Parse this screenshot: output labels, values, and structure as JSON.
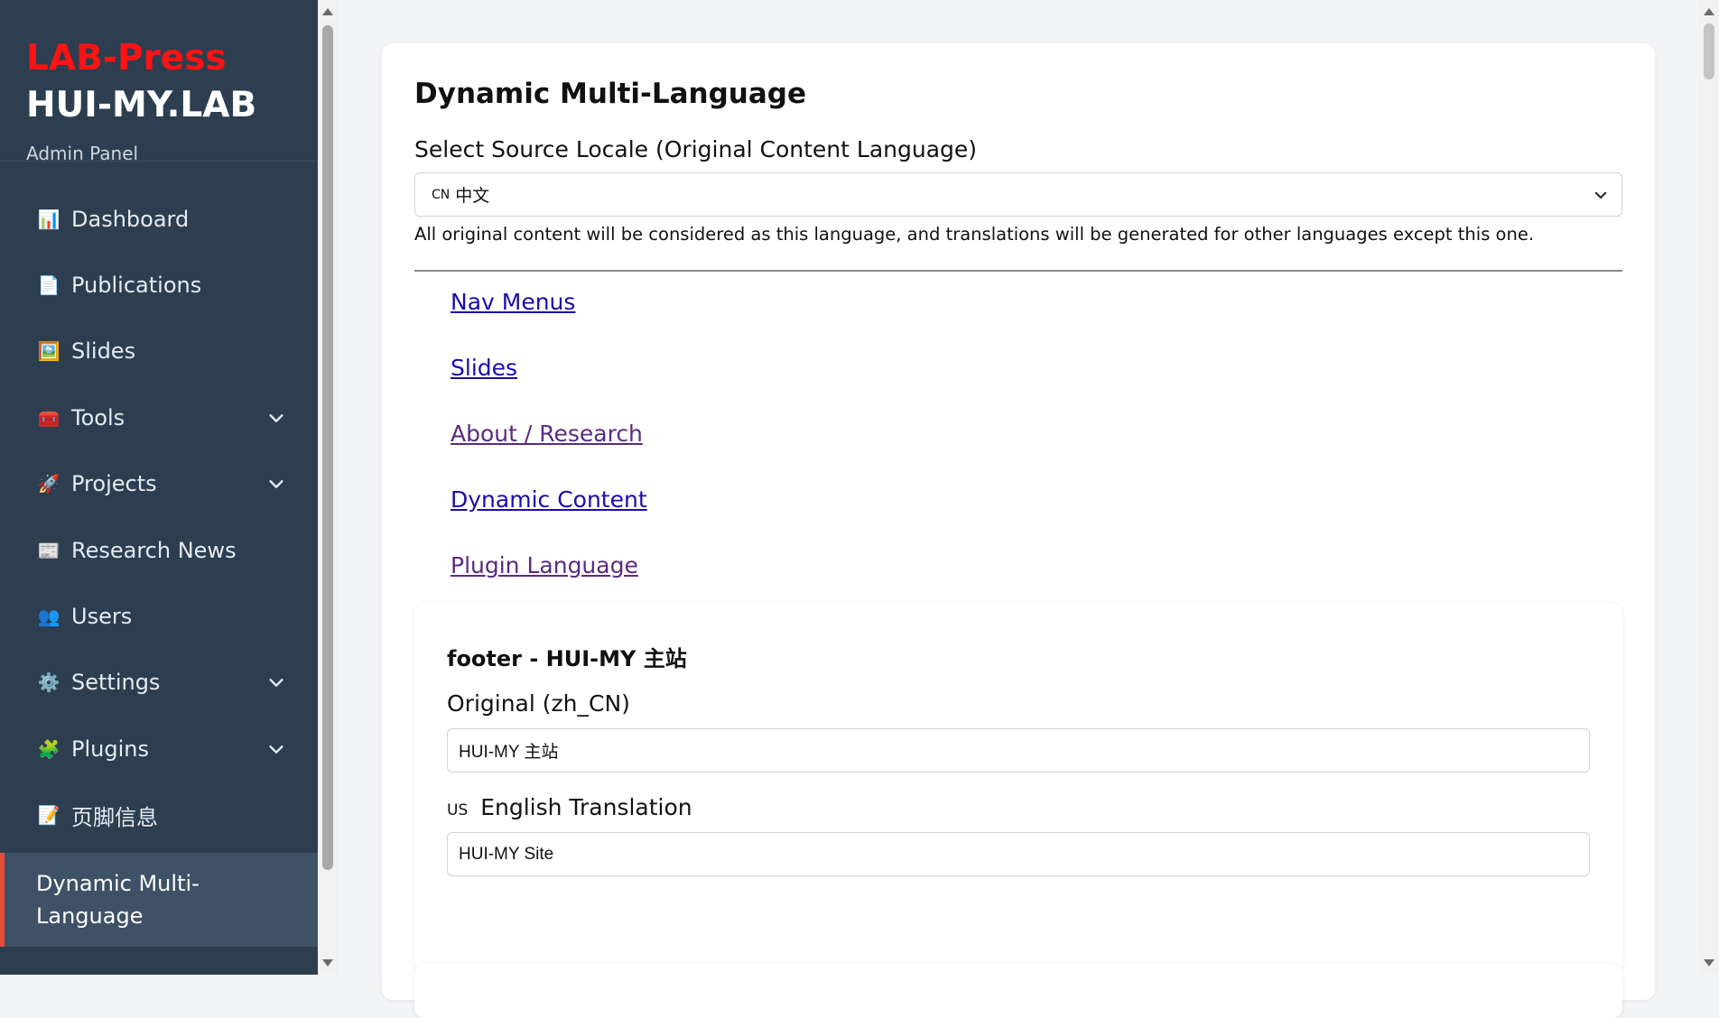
{
  "sidebar": {
    "brand_red": "LAB-Press",
    "brand_main": "HUI-MY.LAB",
    "brand_sub": "Admin Panel",
    "items": [
      {
        "label": "Dashboard",
        "icon": "📊",
        "has_chevron": false
      },
      {
        "label": "Publications",
        "icon": "📄",
        "has_chevron": false
      },
      {
        "label": "Slides",
        "icon": "🖼️",
        "has_chevron": false
      },
      {
        "label": "Tools",
        "icon": "🧰",
        "has_chevron": true
      },
      {
        "label": "Projects",
        "icon": "🚀",
        "has_chevron": true
      },
      {
        "label": "Research News",
        "icon": "📰",
        "has_chevron": false
      },
      {
        "label": "Users",
        "icon": "👥",
        "has_chevron": false
      },
      {
        "label": "Settings",
        "icon": "⚙️",
        "has_chevron": true
      },
      {
        "label": "Plugins",
        "icon": "🧩",
        "has_chevron": true
      },
      {
        "label": "页脚信息",
        "icon": "📝",
        "has_chevron": false
      }
    ],
    "active_item": "Dynamic Multi-Language",
    "active_color": "#e74c3c"
  },
  "main": {
    "title": "Dynamic Multi-Language",
    "source_locale_label": "Select Source Locale (Original Content Language)",
    "source_locale": {
      "flag": "CN",
      "value": "中文"
    },
    "hint": "All original content will be considered as this language, and translations will be generated for other languages except this one.",
    "links": [
      {
        "label": "Nav Menus",
        "visited": false
      },
      {
        "label": "Slides",
        "visited": false
      },
      {
        "label": "About / Research",
        "visited": true
      },
      {
        "label": "Dynamic Content",
        "visited": false
      },
      {
        "label": "Plugin Language",
        "visited": true
      }
    ],
    "entry": {
      "title": "footer - HUI-MY 主站",
      "original_label": "Original (zh_CN)",
      "original_value": "HUI-MY 主站",
      "translation_flag": "US",
      "translation_label": "English Translation",
      "translation_value": "HUI-MY Site"
    }
  }
}
